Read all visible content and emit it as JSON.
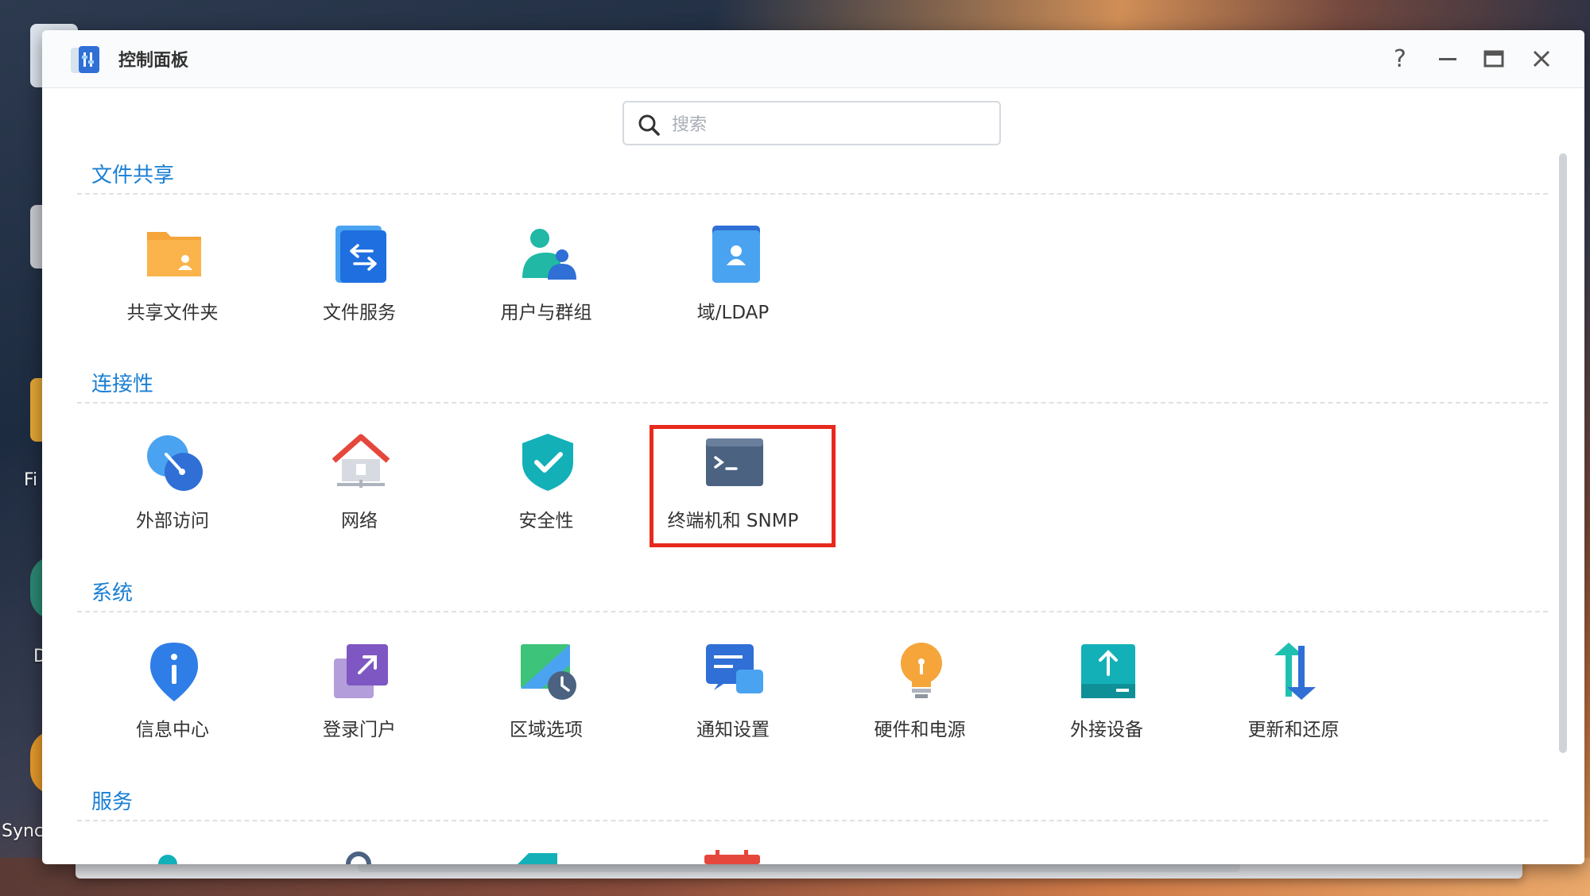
{
  "window": {
    "title": "控制面板"
  },
  "titlebar": {
    "help_label": "?",
    "minimize_label": "—",
    "close_label": "✕"
  },
  "search": {
    "placeholder": "搜索",
    "value": ""
  },
  "desktop": {
    "labels": [
      "Fi",
      "D",
      "Sync"
    ]
  },
  "sections": {
    "file_sharing": {
      "title": "文件共享",
      "items": [
        {
          "label": "共享文件夹",
          "icon": "shared-folder-icon"
        },
        {
          "label": "文件服务",
          "icon": "file-services-icon"
        },
        {
          "label": "用户与群组",
          "icon": "users-groups-icon"
        },
        {
          "label": "域/LDAP",
          "icon": "domain-ldap-icon"
        }
      ]
    },
    "connectivity": {
      "title": "连接性",
      "items": [
        {
          "label": "外部访问",
          "icon": "external-access-icon"
        },
        {
          "label": "网络",
          "icon": "network-icon"
        },
        {
          "label": "安全性",
          "icon": "security-icon"
        },
        {
          "label": "终端机和 SNMP",
          "icon": "terminal-snmp-icon",
          "highlighted": true
        }
      ]
    },
    "system": {
      "title": "系统",
      "items": [
        {
          "label": "信息中心",
          "icon": "info-center-icon"
        },
        {
          "label": "登录门户",
          "icon": "login-portal-icon"
        },
        {
          "label": "区域选项",
          "icon": "regional-options-icon"
        },
        {
          "label": "通知设置",
          "icon": "notification-icon"
        },
        {
          "label": "硬件和电源",
          "icon": "hardware-power-icon"
        },
        {
          "label": "外接设备",
          "icon": "external-devices-icon"
        },
        {
          "label": "更新和还原",
          "icon": "update-restore-icon"
        }
      ]
    },
    "services": {
      "title": "服务"
    }
  },
  "colors": {
    "accent": "#1a7fd4",
    "highlight": "#e8291d"
  }
}
